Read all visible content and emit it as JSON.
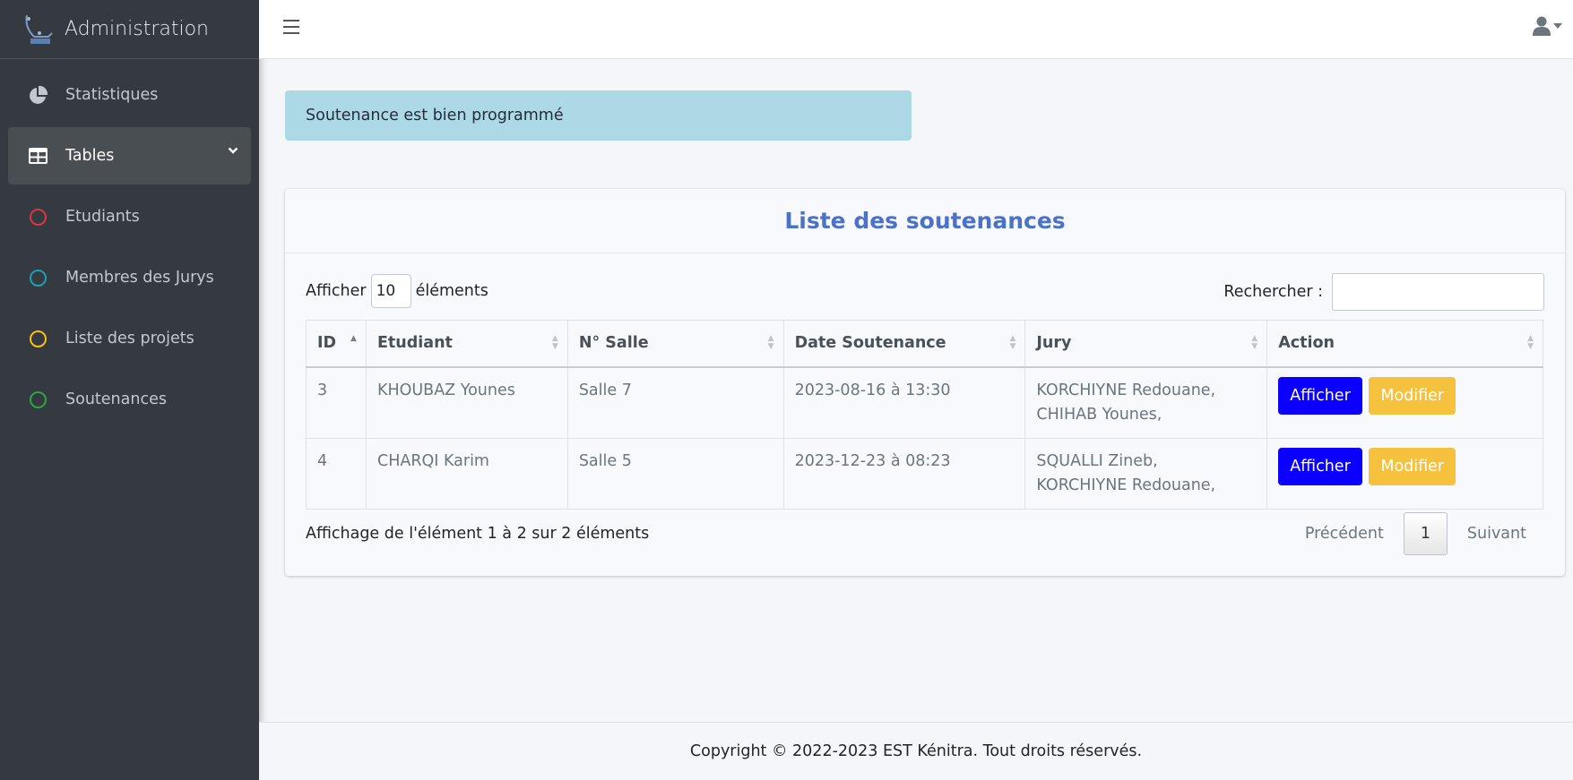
{
  "app": {
    "title": "Administration"
  },
  "sidebar": {
    "items": [
      {
        "label": "Statistiques",
        "icon": "chart-pie-icon"
      },
      {
        "label": "Tables",
        "icon": "table-icon",
        "active": true
      },
      {
        "label": "Etudiants",
        "icon": "circle-red-icon",
        "color": "#dc3545"
      },
      {
        "label": "Membres des Jurys",
        "icon": "circle-cyan-icon",
        "color": "#17a2b8"
      },
      {
        "label": "Liste des projets",
        "icon": "circle-yellow-icon",
        "color": "#ffc107"
      },
      {
        "label": "Soutenances",
        "icon": "circle-green-icon",
        "color": "#28a745"
      }
    ]
  },
  "alert": {
    "message": "Soutenance est bien programmé"
  },
  "card": {
    "title": "Liste des soutenances"
  },
  "datatable": {
    "length_prefix": "Afficher",
    "length_value": "10",
    "length_suffix": "éléments",
    "search_label": "Rechercher :",
    "search_value": "",
    "columns": [
      "ID",
      "Etudiant",
      "N° Salle",
      "Date Soutenance",
      "Jury",
      "Action"
    ],
    "rows": [
      {
        "id": "3",
        "etudiant": "KHOUBAZ Younes",
        "salle": "Salle 7",
        "date": "2023-08-16 à 13:30",
        "jury": [
          "KORCHIYNE Redouane,",
          "CHIHAB Younes,"
        ],
        "actions": [
          "Afficher",
          "Modifier"
        ]
      },
      {
        "id": "4",
        "etudiant": "CHARQI Karim",
        "salle": "Salle 5",
        "date": "2023-12-23 à 08:23",
        "jury": [
          "SQUALLI Zineb,",
          "KORCHIYNE Redouane,"
        ],
        "actions": [
          "Afficher",
          "Modifier"
        ]
      }
    ],
    "info": "Affichage de l'élément 1 à 2 sur 2 éléments",
    "pagination": {
      "prev": "Précédent",
      "current": "1",
      "next": "Suivant"
    }
  },
  "footer": {
    "text": "Copyright © 2022-2023 EST Kénitra. Tout droits réservés."
  },
  "colors": {
    "sidebar_bg": "#343a40",
    "title": "#4a72c6",
    "alert_bg": "#add8e6",
    "btn_primary": "#0b00ff",
    "btn_warning": "#f6c23e"
  }
}
